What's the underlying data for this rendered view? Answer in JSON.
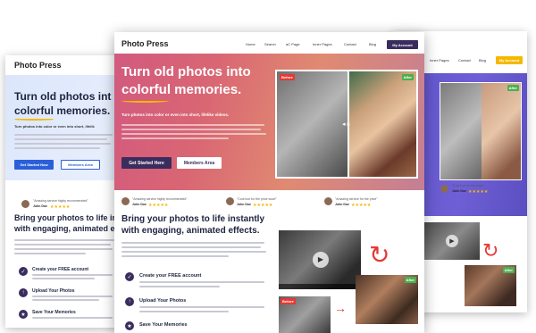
{
  "brand": {
    "name": "Photo Press"
  },
  "nav": {
    "items": [
      "Home",
      "Search",
      "aC Page",
      "Inner Pages",
      "Contact",
      "Blog"
    ],
    "account": "My Account"
  },
  "right_nav": {
    "items": [
      "Inner Pages",
      "Contact",
      "Blog"
    ],
    "account": "My Account"
  },
  "hero": {
    "title_line1": "Turn old photos into",
    "title_line2": "colorful memories.",
    "subtitle": "Turn photos into color or even into short, lifelike videos.",
    "get_started": "Get Started Here",
    "members": "Members Area",
    "badge_before": "Before",
    "badge_after": "After"
  },
  "left_hero": {
    "title_line1": "Turn old photos int",
    "title_line2": "colorful memories.",
    "subtitle": "Turn photos into color or even into short, lifelik",
    "get_started": "Get Started Now",
    "members": "Members Area"
  },
  "testimonials": [
    {
      "quote": "\"Amazing service highly recommended\"",
      "name": "John Doe"
    },
    {
      "quote": "\"Cool tool for the price wow!\"",
      "name": "John Doe"
    },
    {
      "quote": "\"Amazing service for the price\"",
      "name": "John Doe"
    }
  ],
  "left_testimonial": {
    "quote": "\"Amazing service highly recommended\"",
    "name": "John Doe"
  },
  "right_testimonial": {
    "quote": "\"Cool tool for the price\"",
    "name": "John Doe"
  },
  "section": {
    "title_line1": "Bring your photos to life instantly",
    "title_line2": "with engaging, animated effects."
  },
  "left_section": {
    "title_line1": "Bring your photos to life instant",
    "title_line2": "with engaging, animated effect"
  },
  "features": [
    {
      "title": "Create your FREE account"
    },
    {
      "title": "Upload Your Photos"
    },
    {
      "title": "Save Your Memories"
    }
  ],
  "colors": {
    "purple": "#3a2d5e",
    "accent_yellow": "#f5b800",
    "after_green": "#4caf50",
    "before_red": "#e53935"
  }
}
